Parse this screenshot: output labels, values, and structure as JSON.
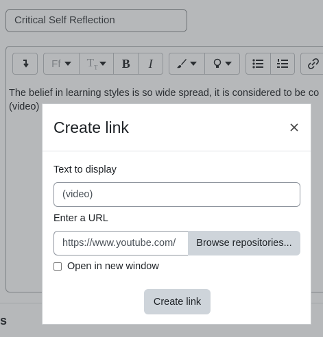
{
  "page": {
    "title_field_value": "Critical Self Reflection",
    "editor_text_line1": "The belief in learning styles is so wide spread, it is considered to be co",
    "editor_text_line2": "(video)",
    "bottom_partial_char": "s"
  },
  "toolbar": {
    "font_family_label": "Ff",
    "bold_label": "B",
    "italic_label": "I",
    "icons": [
      "undo-arrow-icon",
      "font-family-icon",
      "font-size-icon",
      "bold-icon",
      "italic-icon",
      "paint-brush-icon",
      "lightbulb-icon",
      "bullet-list-icon",
      "numbered-list-icon",
      "link-icon"
    ]
  },
  "modal": {
    "title": "Create link",
    "text_to_display_label": "Text to display",
    "text_to_display_value": "(video)",
    "url_label": "Enter a URL",
    "url_value": "https://www.youtube.com/",
    "browse_button": "Browse repositories...",
    "open_new_window_label": "Open in new window",
    "open_new_window_checked": false,
    "create_button": "Create link"
  },
  "colors": {
    "backdrop": "#b6b8ba",
    "modal_bg": "#ffffff",
    "button_bg": "#ced4da"
  }
}
